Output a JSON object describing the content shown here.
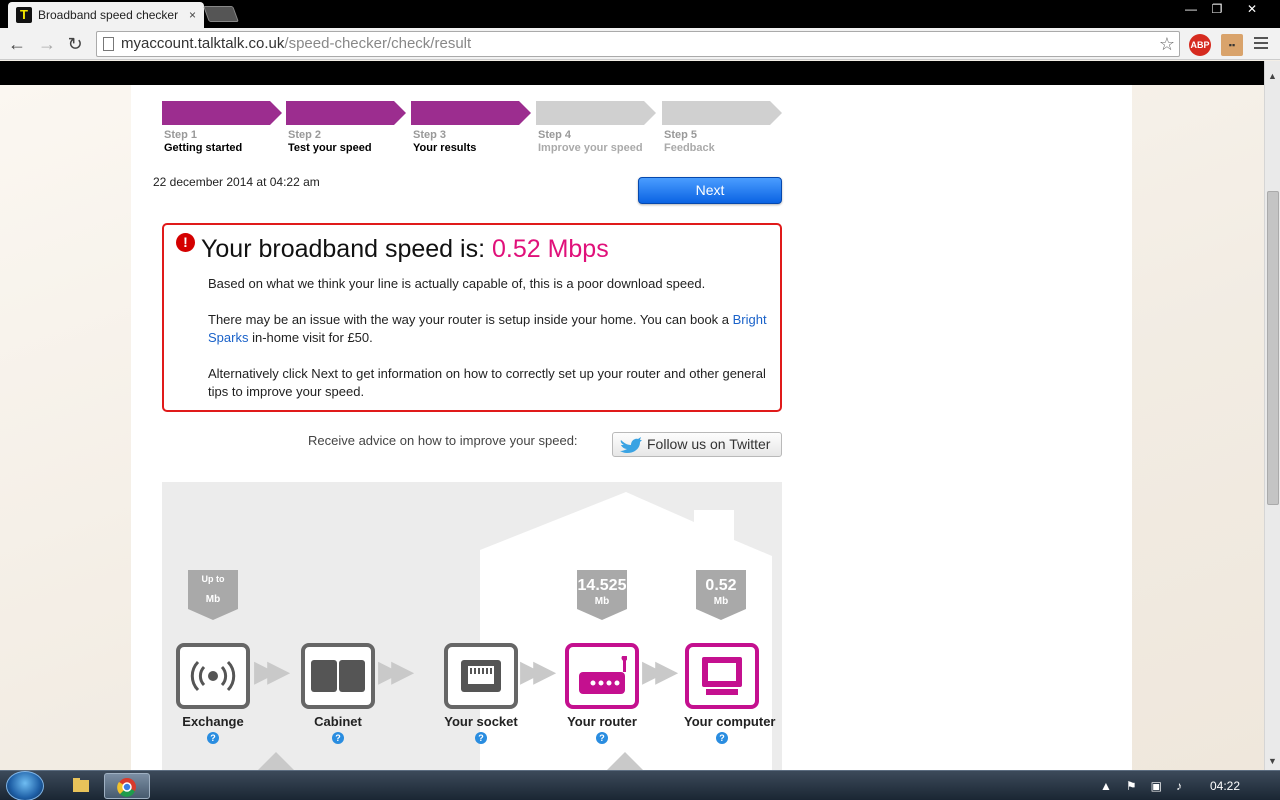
{
  "browser": {
    "tab_title": "Broadband speed checker",
    "tab_close": "×",
    "url_domain": "myaccount.talktalk.co.uk",
    "url_path": "/speed-checker/check/result",
    "back_icon": "←",
    "forward_icon": "→",
    "reload_icon": "↻",
    "star_icon": "☆",
    "ext_abp": "ABP",
    "window_buttons": {
      "minimize": "—",
      "restore": "❐",
      "close": "✕"
    }
  },
  "steps": [
    {
      "num": "Step 1",
      "name": "Getting started",
      "active": true
    },
    {
      "num": "Step 2",
      "name": "Test your speed",
      "active": true
    },
    {
      "num": "Step 3",
      "name": "Your results",
      "active": true
    },
    {
      "num": "Step 4",
      "name": "Improve your speed",
      "active": false
    },
    {
      "num": "Step 5",
      "name": "Feedback",
      "active": false
    }
  ],
  "date_text": "22 december 2014 at 04:22 am",
  "next_label": "Next",
  "result": {
    "headline_prefix": "Your broadband speed is: ",
    "speed": "0.52 Mbps",
    "para1": "Based on what we think your line is actually capable of, this is a poor download speed.",
    "para2_before": "There may be an issue with the way your router is setup inside your home. You can book a ",
    "para2_link": "Bright Sparks",
    "para2_after": " in-home visit for £50.",
    "para3": "Alternatively click Next to get information on how to correctly set up your router and other general tips to improve your speed."
  },
  "advice_text": "Receive advice on how to improve your speed:",
  "twitter_label": "Follow us on Twitter",
  "diagram": {
    "nodes": [
      "Exchange",
      "Cabinet",
      "Your socket",
      "Your router",
      "Your computer"
    ],
    "badges": {
      "exchange": {
        "top": "Up to",
        "unit": "Mb"
      },
      "router": {
        "value": "14.525",
        "unit": "Mb"
      },
      "computer": {
        "value": "0.52",
        "unit": "Mb"
      }
    },
    "help": "?",
    "accent_pink": "#c4108f"
  },
  "taskbar": {
    "clock": "04:22"
  },
  "colors": {
    "step_active": "#9c2d8f",
    "speed_pink": "#e0107a",
    "alert_red": "#e01a1a"
  }
}
